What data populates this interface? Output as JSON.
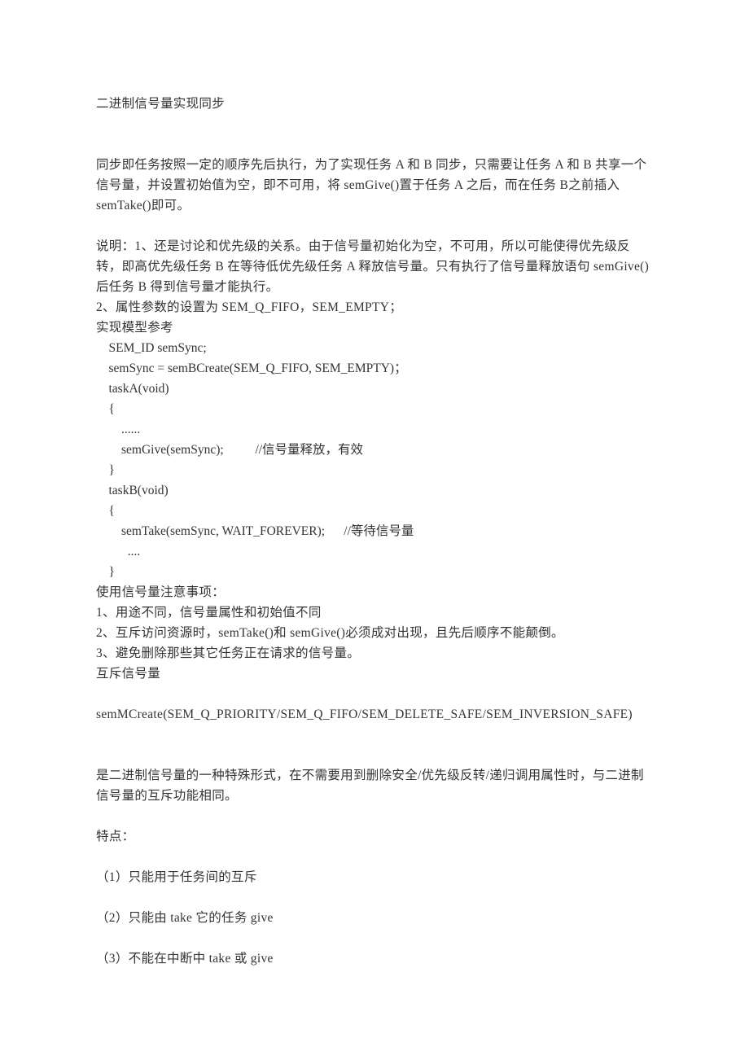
{
  "title": "二进制信号量实现同步",
  "p1": "同步即任务按照一定的顺序先后执行，为了实现任务 A 和 B 同步，只需要让任务 A 和 B 共享一个信号量，并设置初始值为空，即不可用，将 semGive()置于任务 A 之后，而在任务 B之前插入 semTake()即可。",
  "p2a": "说明：1、还是讨论和优先级的关系。由于信号量初始化为空，不可用，所以可能使得优先级反转，即高优先级任务 B 在等待低优先级任务 A 释放信号量。只有执行了信号量释放语句 semGive()后任务 B 得到信号量才能执行。",
  "p2b": "2、属性参数的设置为 SEM_Q_FIFO，SEM_EMPTY；",
  "p2c": "实现模型参考",
  "code": {
    "l1": "    SEM_ID semSync;",
    "l2": "    semSync = semBCreate(SEM_Q_FIFO, SEM_EMPTY)；",
    "l3": "    taskA(void)",
    "l4": "    {",
    "l5": "        ......",
    "l6": "        semGive(semSync);          //信号量释放，有效",
    "l7": "    }",
    "l8": "    taskB(void)",
    "l9": "    {",
    "l10": "        semTake(semSync, WAIT_FOREVER);      //等待信号量",
    "l11": "          ....",
    "l12": "    }"
  },
  "notes_title": "使用信号量注意事项：",
  "note1": "1、用途不同，信号量属性和初始值不同",
  "note2": "2、互斥访问资源时，semTake()和 semGive()必须成对出现，且先后顺序不能颠倒。",
  "note3": "3、避免删除那些其它任务正在请求的信号量。",
  "mutex_title": "互斥信号量",
  "mutex_line": "semMCreate(SEM_Q_PRIORITY/SEM_Q_FIFO/SEM_DELETE_SAFE/SEM_INVERSION_SAFE)",
  "mutex_desc": "是二进制信号量的一种特殊形式，在不需要用到删除安全/优先级反转/递归调用属性时，与二进制信号量的互斥功能相同。",
  "features_title": "特点：",
  "feat1": "（1）只能用于任务间的互斥",
  "feat2": "（2）只能由 take 它的任务 give",
  "feat3": "（3）不能在中断中 take 或 give"
}
